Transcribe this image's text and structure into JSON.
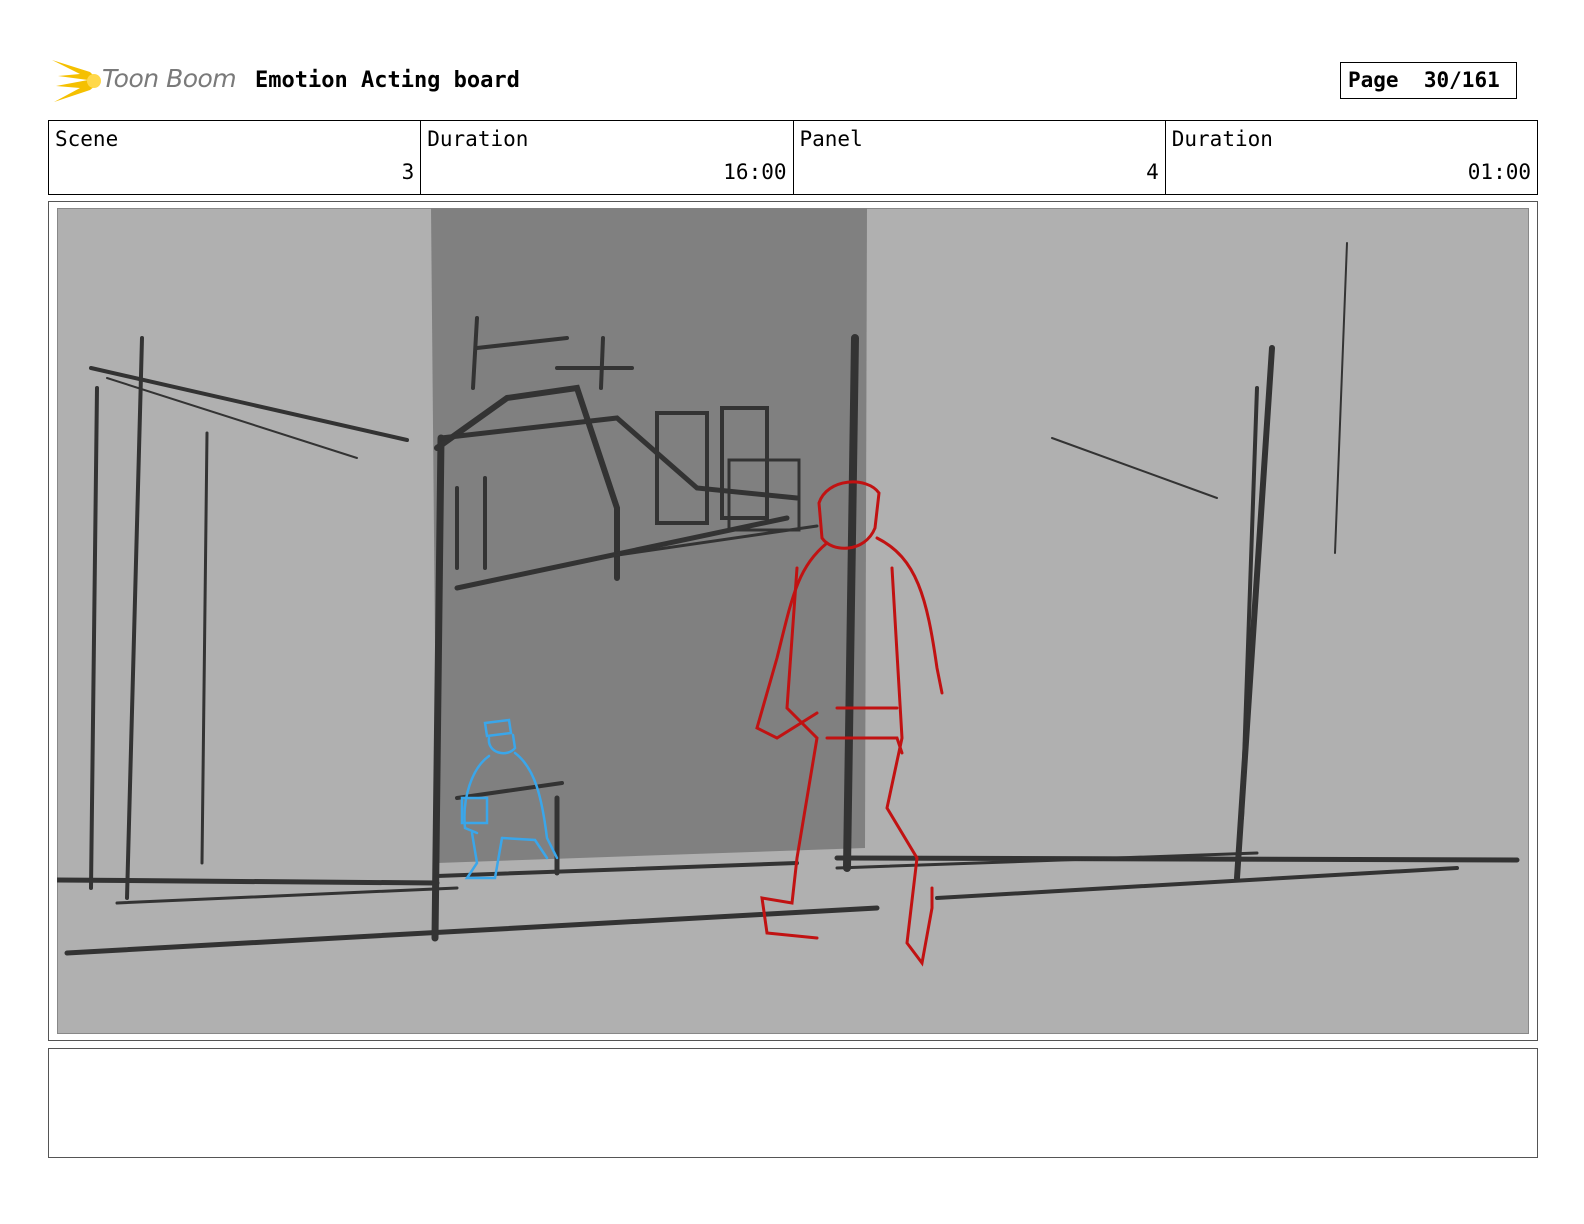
{
  "header": {
    "brand": "Toon Boom",
    "title": "Emotion Acting board",
    "page_label": "Page",
    "page_value": "30/161"
  },
  "info": {
    "scene_label": "Scene",
    "scene_value": "3",
    "scene_duration_label": "Duration",
    "scene_duration_value": "16:00",
    "panel_label": "Panel",
    "panel_value": "4",
    "panel_duration_label": "Duration",
    "panel_duration_value": "01:00"
  },
  "colors": {
    "background_gray": "#b0b0b0",
    "doorway_gray": "#808080",
    "line_dark": "#333333",
    "figure_red": "#c11212",
    "figure_blue": "#3aa6ea",
    "logo_yellow": "#f5c000"
  },
  "icons": {
    "logo": "toon-boom-starburst-icon"
  }
}
